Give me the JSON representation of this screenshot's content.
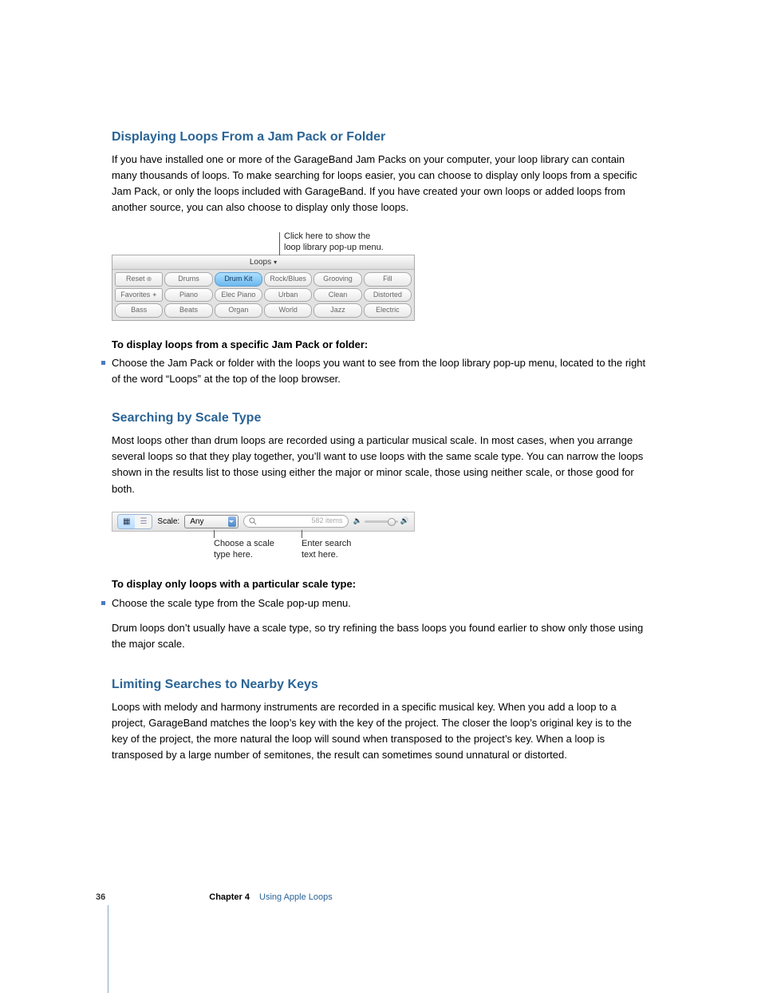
{
  "section1": {
    "heading": "Displaying Loops From a Jam Pack or Folder",
    "para": "If you have installed one or more of the GarageBand Jam Packs on your computer, your loop library can contain many thousands of loops. To make searching for loops easier, you can choose to display only loops from a specific Jam Pack, or only the loops included with GarageBand. If you have created your own loops or added loops from another source, you can also choose to display only those loops."
  },
  "loop_annotation": {
    "line1": "Click here to show the",
    "line2": "loop library pop-up menu."
  },
  "loop_browser": {
    "header": "Loops",
    "rows": [
      [
        "Reset",
        "Drums",
        "Drum Kit",
        "Rock/Blues",
        "Grooving",
        "Fill"
      ],
      [
        "Favorites",
        "Piano",
        "Elec Piano",
        "Urban",
        "Clean",
        "Distorted"
      ],
      [
        "Bass",
        "Beats",
        "Organ",
        "World",
        "Jazz",
        "Electric"
      ]
    ]
  },
  "section1b": {
    "intro": "To display loops from a specific Jam Pack or folder:",
    "bullet": "Choose the Jam Pack or folder with the loops you want to see from the loop library pop-up menu, located to the right of the word “Loops” at the top of the loop browser."
  },
  "section2": {
    "heading": "Searching by Scale Type",
    "para": "Most loops other than drum loops are recorded using a particular musical scale. In most cases, when you arrange several loops so that they play together, you’ll want to use loops with the same scale type. You can narrow the loops shown in the results list to those using either the major or minor scale, those using neither scale, or those good for both."
  },
  "scale_toolbar": {
    "scale_label": "Scale:",
    "scale_value": "Any",
    "items_count": "582 items"
  },
  "scale_annotation": {
    "left1": "Choose a scale",
    "left2": "type here.",
    "right1": "Enter search",
    "right2": "text here."
  },
  "section2b": {
    "intro": "To display only loops with a particular scale type:",
    "bullet": "Choose the scale type from the Scale pop-up menu.",
    "after": "Drum loops don’t usually have a scale type, so try refining the bass loops you found earlier to show only those using the major scale."
  },
  "section3": {
    "heading": "Limiting Searches to Nearby Keys",
    "para": "Loops with melody and harmony instruments are recorded in a specific musical key. When you add a loop to a project, GarageBand matches the loop’s key with the key of the project. The closer the loop’s original key is to the key of the project, the more natural the loop will sound when transposed to the project’s key. When a loop is transposed by a large number of semitones, the result can sometimes sound unnatural or distorted."
  },
  "footer": {
    "page_number": "36",
    "chapter": "Chapter 4",
    "chapter_title": "Using Apple Loops"
  }
}
